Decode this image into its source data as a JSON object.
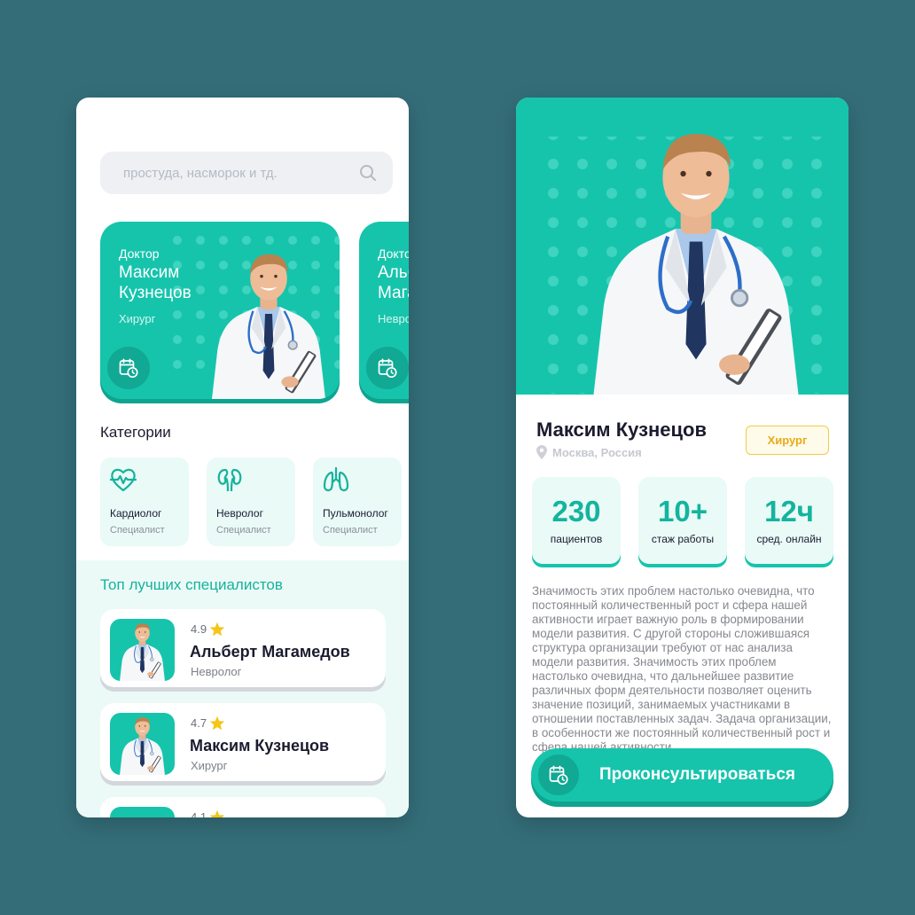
{
  "left_screen": {
    "search": {
      "placeholder": "простуда, насморок и тд.",
      "icon": "search-icon"
    },
    "doctor_cards": [
      {
        "title": "Доктор",
        "name": "Максим Кузнецов",
        "specialty": "Хирург",
        "icon": "calendar-clock-icon"
      },
      {
        "title": "Доктор",
        "name": "Альберт Магамедов",
        "specialty": "Невролог",
        "icon": "calendar-clock-icon"
      }
    ],
    "categories": {
      "title": "Категории",
      "items": [
        {
          "name": "Кардиолог",
          "sub": "Специалист",
          "icon": "heart-pulse-icon"
        },
        {
          "name": "Невролог",
          "sub": "Специалист",
          "icon": "kidneys-icon"
        },
        {
          "name": "Пульмонолог",
          "sub": "Специалист",
          "icon": "lungs-icon"
        }
      ]
    },
    "top": {
      "title": "Топ лучших специалистов",
      "items": [
        {
          "rating": "4.9",
          "name": "Альберт Магамедов",
          "specialty": "Невролог"
        },
        {
          "rating": "4.7",
          "name": "Максим Кузнецов",
          "specialty": "Хирург"
        },
        {
          "rating": "4.1",
          "name": "",
          "specialty": ""
        }
      ]
    }
  },
  "right_screen": {
    "name": "Максим Кузнецов",
    "location": "Москва, Россия",
    "badge": "Хирург",
    "stats": [
      {
        "value": "230",
        "label": "пациентов"
      },
      {
        "value": "10+",
        "label": "стаж работы"
      },
      {
        "value": "12ч",
        "label": "сред. онлайн"
      }
    ],
    "description": "Значимость этих проблем настолько очевидна, что постоянный количественный рост и сфера нашей активности играет важную роль в формировании модели развития. С другой стороны сложившаяся структура организации требуют от нас анализа модели развития. Значимость этих проблем настолько очевидна, что дальнейшее развитие различных форм деятельности позволяет оценить значение позиций, занимаемых участниками в отношении поставленных задач. Задача организации, в особенности же постоянный количественный рост и сфера нашей активности",
    "cta": "Проконсультироваться"
  },
  "colors": {
    "background": "#346d78",
    "accent": "#16c4ac",
    "accent_dark": "#0ea48f",
    "badge": "#e8ab18",
    "star": "#f5c518"
  }
}
